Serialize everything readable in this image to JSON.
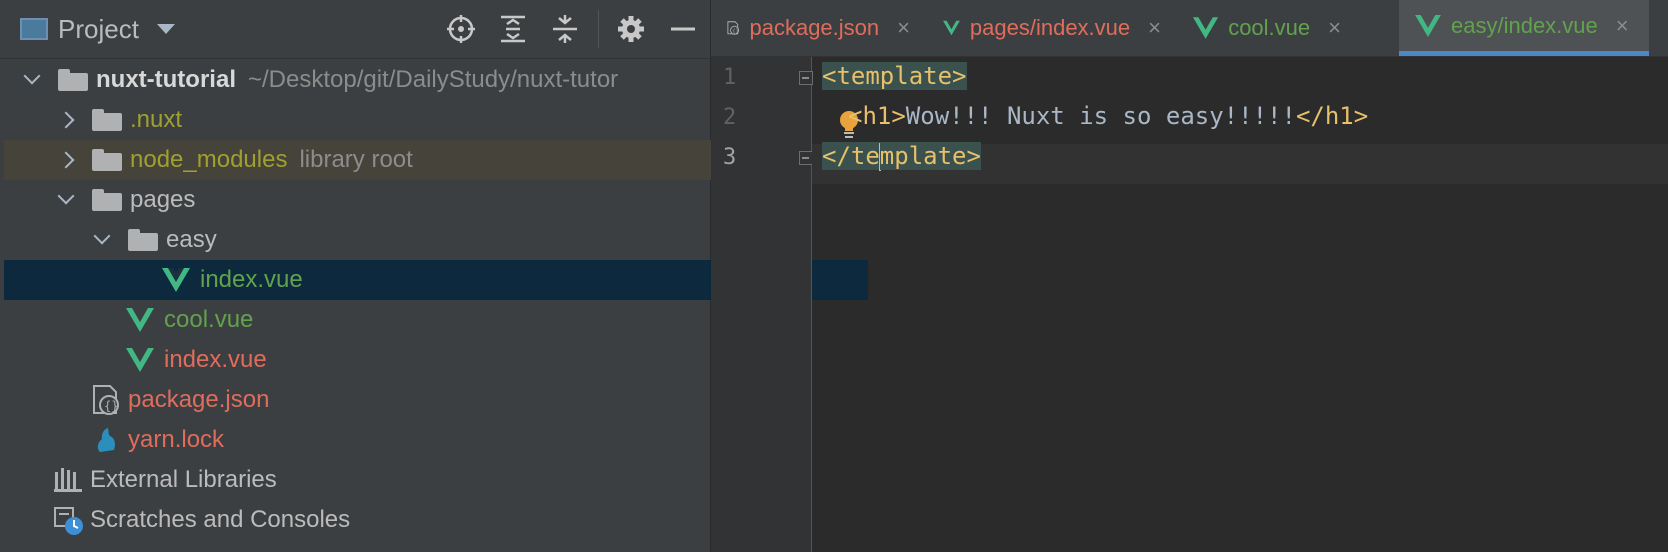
{
  "project_panel": {
    "title": "Project",
    "toolbar_icons": [
      "locate-icon",
      "expand-all-icon",
      "collapse-all-icon",
      "gear-icon",
      "minimize-icon"
    ],
    "tree": [
      {
        "label": "nuxt-tutorial",
        "hint": "~/Desktop/git/DailyStudy/nuxt-tutor",
        "icon": "folder-icon",
        "expanded": true
      },
      {
        "label": ".nuxt",
        "icon": "folder-icon",
        "expanded": false,
        "color": "#a0a030"
      },
      {
        "label": "node_modules",
        "hint": "library root",
        "icon": "folder-icon",
        "expanded": false,
        "color": "#a0a030"
      },
      {
        "label": "pages",
        "icon": "folder-icon",
        "expanded": true
      },
      {
        "label": "easy",
        "icon": "folder-icon",
        "expanded": true
      },
      {
        "label": "index.vue",
        "icon": "vue-icon",
        "selected": true,
        "color": "#62a24d"
      },
      {
        "label": "cool.vue",
        "icon": "vue-icon",
        "color": "#62a24d"
      },
      {
        "label": "index.vue",
        "icon": "vue-icon",
        "color": "#e06c5c"
      },
      {
        "label": "package.json",
        "icon": "json-file-icon",
        "color": "#e06c5c"
      },
      {
        "label": "yarn.lock",
        "icon": "yarn-icon",
        "color": "#e06c5c"
      },
      {
        "label": "External Libraries",
        "icon": "libraries-icon"
      },
      {
        "label": "Scratches and Consoles",
        "icon": "scratches-icon"
      }
    ]
  },
  "editor": {
    "tabs": [
      {
        "label": "package.json",
        "icon": "json-file-icon",
        "color": "#e06c5c",
        "active": false
      },
      {
        "label": "pages/index.vue",
        "icon": "vue-icon",
        "color": "#e06c5c",
        "active": false
      },
      {
        "label": "cool.vue",
        "icon": "vue-icon",
        "color": "#62a24d",
        "active": false
      },
      {
        "label": "easy/index.vue",
        "icon": "vue-icon",
        "color": "#62a24d",
        "active": true
      }
    ],
    "close_glyph": "×",
    "line_numbers": [
      "1",
      "2",
      "3"
    ],
    "lines": {
      "l1_tag": "<template>",
      "l2_open": "<h1>",
      "l2_text": "Wow!!! Nuxt is so easy!!!!!",
      "l2_close": "</h1>",
      "l3_a": "</te",
      "l3_b": "mplate>"
    }
  },
  "colors": {
    "modified_file": "#e06c5c",
    "added_file": "#62a24d",
    "excluded_folder": "#a0a030",
    "active_tab_underline": "#4a88c7",
    "selection": "#0d293e"
  }
}
